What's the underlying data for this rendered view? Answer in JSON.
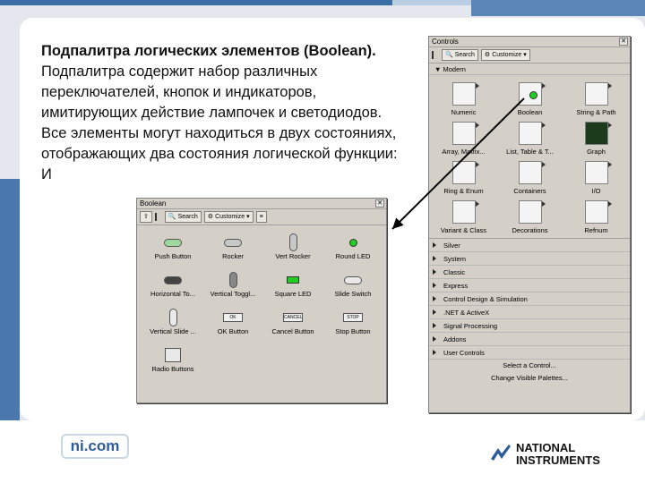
{
  "slide": {
    "title": "Подпалитра логических элементов (Boolean).",
    "body": "Подпалитра содержит набор различных переключателей, кнопок и индикаторов, имитирующих действие лампочек и светодиодов. Все элементы могут находиться в двух состояниях, отображающих два состояния логической функции: И",
    "footer_link": "ni.com",
    "logo_line1": "NATIONAL",
    "logo_line2": "INSTRUMENTS"
  },
  "controls_palette": {
    "title": "Controls",
    "search_label": "Search",
    "customize_label": "Customize",
    "section_label": "Modern",
    "items": [
      {
        "label": "Numeric",
        "icon": "numeric-icon"
      },
      {
        "label": "Boolean",
        "icon": "boolean-icon"
      },
      {
        "label": "String & Path",
        "icon": "string-path-icon"
      },
      {
        "label": "Array, Matrix...",
        "icon": "array-icon"
      },
      {
        "label": "List, Table & T...",
        "icon": "list-icon"
      },
      {
        "label": "Graph",
        "icon": "graph-icon"
      },
      {
        "label": "Ring & Enum",
        "icon": "ring-icon"
      },
      {
        "label": "Containers",
        "icon": "containers-icon"
      },
      {
        "label": "I/O",
        "icon": "io-icon"
      },
      {
        "label": "Variant & Class",
        "icon": "variant-icon"
      },
      {
        "label": "Decorations",
        "icon": "decorations-icon"
      },
      {
        "label": "Refnum",
        "icon": "refnum-icon"
      }
    ],
    "categories": [
      "Silver",
      "System",
      "Classic",
      "Express",
      "Control Design & Simulation",
      ".NET & ActiveX",
      "Signal Processing",
      "Addons",
      "User Controls"
    ],
    "select_control": "Select a Control...",
    "change_palettes": "Change Visible Palettes..."
  },
  "boolean_palette": {
    "title": "Boolean",
    "search_label": "Search",
    "customize_label": "Customize",
    "items": [
      "Push Button",
      "Rocker",
      "Vert Rocker",
      "Round LED",
      "Horizontal To...",
      "Vertical Toggl...",
      "Square LED",
      "Slide Switch",
      "Vertical Slide ...",
      "OK Button",
      "Cancel Button",
      "Stop Button",
      "Radio Buttons"
    ],
    "mini_labels": {
      "ok": "OK",
      "cancel": "CANCEL",
      "stop": "STOP"
    }
  },
  "colors": {
    "accent": "#3a6ea5",
    "led_green": "#22cc22",
    "palette_bg": "#d4d0c8"
  }
}
